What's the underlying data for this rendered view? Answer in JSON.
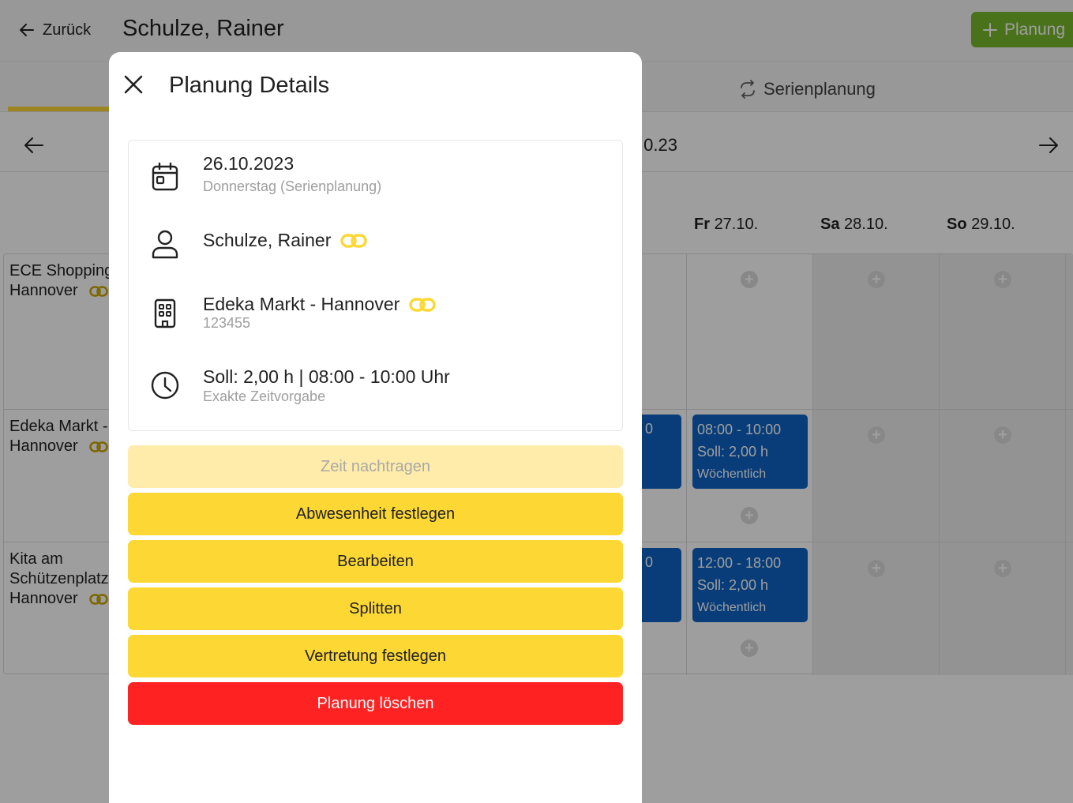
{
  "header": {
    "back_label": "Zurück",
    "title": "Schulze, Rainer",
    "add_label": "Planung",
    "accent_color": "#77b82a"
  },
  "tabs": {
    "serien_label": "Serienplanung",
    "active_color": "#fdd835"
  },
  "week": {
    "label_partial": "0.23"
  },
  "days": [
    {
      "abbr": "Fr",
      "date": "27.10."
    },
    {
      "abbr": "Sa",
      "date": "28.10."
    },
    {
      "abbr": "So",
      "date": "29.10."
    }
  ],
  "rows": [
    {
      "line1": "ECE Shopping",
      "line2": "Hannover"
    },
    {
      "line1": "Edeka Markt -",
      "line2": "Hannover"
    },
    {
      "line1": "Kita am",
      "line2": "Schützenplatz",
      "line3": "Hannover"
    }
  ],
  "events": [
    {
      "time": "08:00 - 10:00",
      "soll": "Soll: 2,00 h",
      "freq": "Wöchentlich",
      "stub": "0"
    },
    {
      "time": "12:00 - 18:00",
      "soll": "Soll: 2,00 h",
      "freq": "Wöchentlich",
      "stub": "0"
    }
  ],
  "dialog": {
    "title": "Planung Details",
    "date": "26.10.2023",
    "date_sub": "Donnerstag (Serienplanung)",
    "person": "Schulze, Rainer",
    "location": "Edeka Markt - Hannover",
    "location_sub": "123455",
    "time": "Soll: 2,00 h | 08:00 - 10:00 Uhr",
    "time_sub": "Exakte Zeitvorgabe",
    "link_color": "#fdd835",
    "actions": {
      "zeit": "Zeit nachtragen",
      "abwesenheit": "Abwesenheit festlegen",
      "bearbeiten": "Bearbeiten",
      "splitten": "Splitten",
      "vertretung": "Vertretung festlegen",
      "loeschen": "Planung löschen"
    },
    "delete_color": "#ff2222"
  }
}
